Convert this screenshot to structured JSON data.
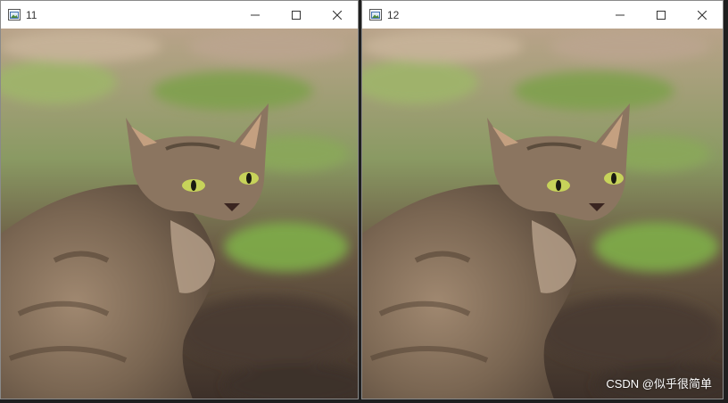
{
  "windows": [
    {
      "title": "11"
    },
    {
      "title": "12"
    }
  ],
  "controls": {
    "minimize": "minimize-icon",
    "maximize": "maximize-icon",
    "close": "close-icon"
  },
  "watermark": "CSDN @似乎很简单",
  "colors": {
    "titlebar_bg": "#ffffff",
    "window_border": "#8a8a8a",
    "outer_bg": "#1f1f1f"
  }
}
